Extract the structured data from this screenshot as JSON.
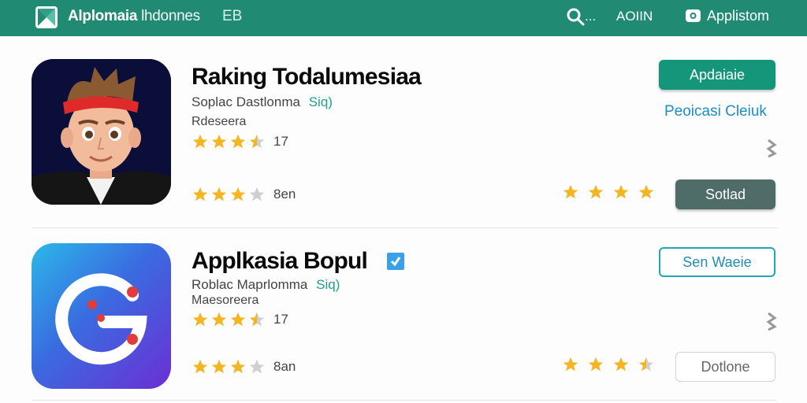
{
  "header": {
    "app_name_bold": "Alplomaia",
    "app_name_rest": "lhdonnes",
    "app_code": "EB",
    "search_suffix": "...",
    "nav_code": "AOIIN",
    "nav_right": "Applistom",
    "bar_color": "#208a73"
  },
  "apps": [
    {
      "title": "Raking Todalumesiaa",
      "developer": "Soplac Dastlonma",
      "tag": "Siq)",
      "category": "Rdeseera",
      "rating_count": "17",
      "row_count_label": "8en",
      "rating_stars": 3.5,
      "lower_stars": 3,
      "right_stars": 4,
      "primary_button": "Apdaiaie",
      "link": "Peoicasi Cleiuk",
      "secondary_button": "Sotlad",
      "icon": "avatar-character-icon"
    },
    {
      "title": "Applkasia Bopul",
      "developer": "Roblac Maprlomma",
      "tag": "Siq)",
      "category": "Maesoreera",
      "rating_count": "17",
      "row_count_label": "8an",
      "rating_stars": 3.5,
      "lower_stars": 3,
      "right_stars": 3.5,
      "primary_button": "Sen Waeie",
      "secondary_button": "Dotlone",
      "icon": "g-logo-icon"
    }
  ]
}
